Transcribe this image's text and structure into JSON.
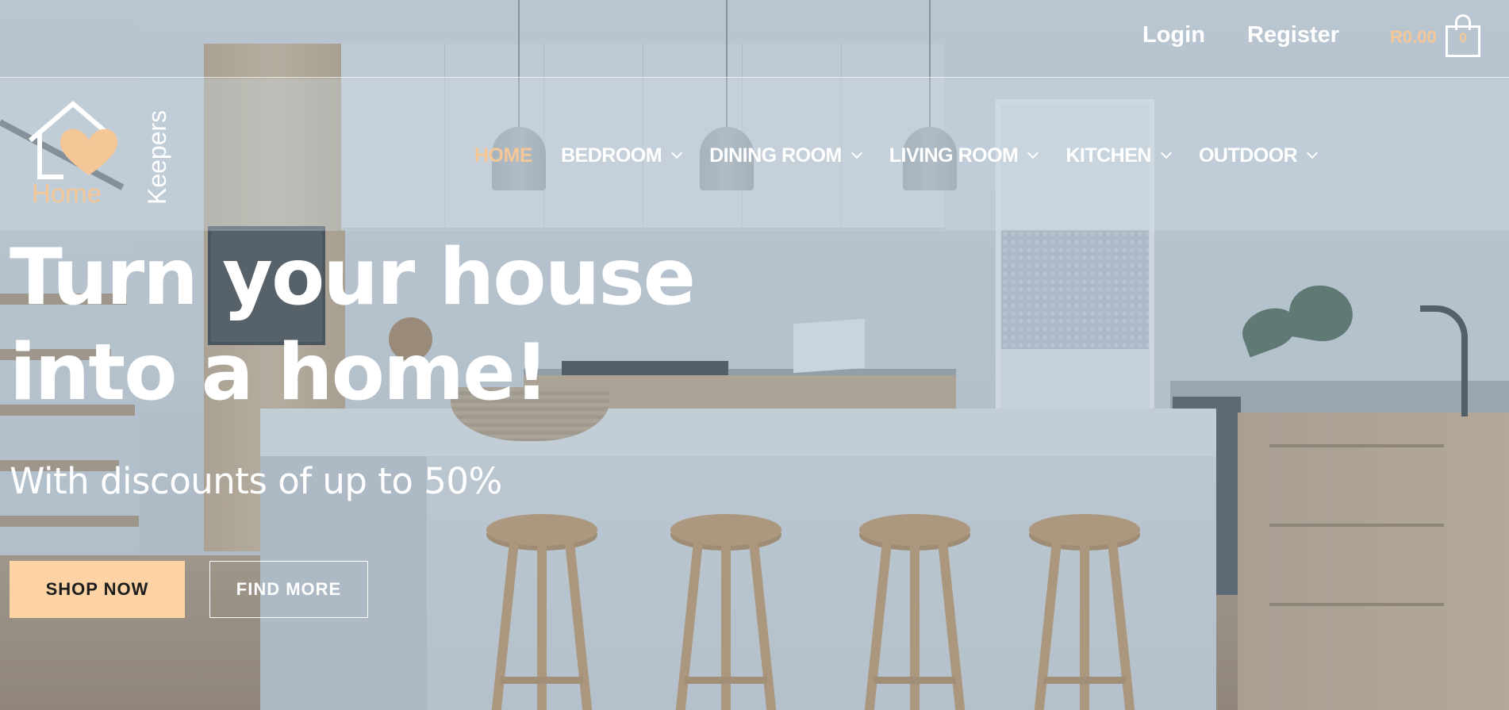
{
  "header": {
    "login_label": "Login",
    "register_label": "Register",
    "cart_total": "R0.00",
    "cart_count": "0"
  },
  "logo": {
    "word_home": "Home",
    "word_keepers": "Keepers"
  },
  "nav": {
    "items": [
      {
        "label": "HOME",
        "active": true
      },
      {
        "label": "BEDROOM",
        "has_dropdown": true
      },
      {
        "label": "DINING ROOM",
        "has_dropdown": true
      },
      {
        "label": "LIVING ROOM",
        "has_dropdown": true
      },
      {
        "label": "KITCHEN",
        "has_dropdown": true
      },
      {
        "label": "OUTDOOR",
        "has_dropdown": true
      }
    ]
  },
  "hero": {
    "title_line1": "Turn your house",
    "title_line2": "into a home!",
    "subtitle": "With discounts of up to 50%",
    "shop_now_label": "SHOP NOW",
    "find_more_label": "FIND MORE"
  },
  "colors": {
    "accent": "#f6c796",
    "button_fill": "#fdd3a5",
    "text_light": "#ffffff"
  },
  "icons": {
    "cart": "shopping-bag-icon",
    "dropdown": "chevron-down-icon",
    "logo": "house-heart-logo"
  }
}
